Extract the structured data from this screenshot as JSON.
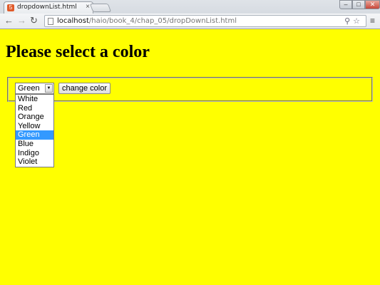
{
  "browser": {
    "tab_title": "dropdownList.html",
    "tab_close": "×",
    "favicon_glyph": "5",
    "url_host": "localhost",
    "url_path": "/haio/book_4/chap_05/dropDownList.html",
    "icons": {
      "back": "back-arrow-icon",
      "forward": "forward-arrow-icon",
      "reload": "reload-icon",
      "search": "magnifier-icon",
      "star": "star-icon",
      "menu": "hamburger-menu-icon"
    },
    "window_controls": {
      "minimize": "–",
      "maximize": "□",
      "close": "✕"
    }
  },
  "page": {
    "heading": "Please select a color",
    "select": {
      "selected": "Green",
      "options": [
        "White",
        "Red",
        "Orange",
        "Yellow",
        "Green",
        "Blue",
        "Indigo",
        "Violet"
      ],
      "highlighted_option": "Green"
    },
    "button_label": "change color"
  },
  "colors": {
    "page_background": "#ffff00",
    "option_highlight": "#3399ff"
  }
}
